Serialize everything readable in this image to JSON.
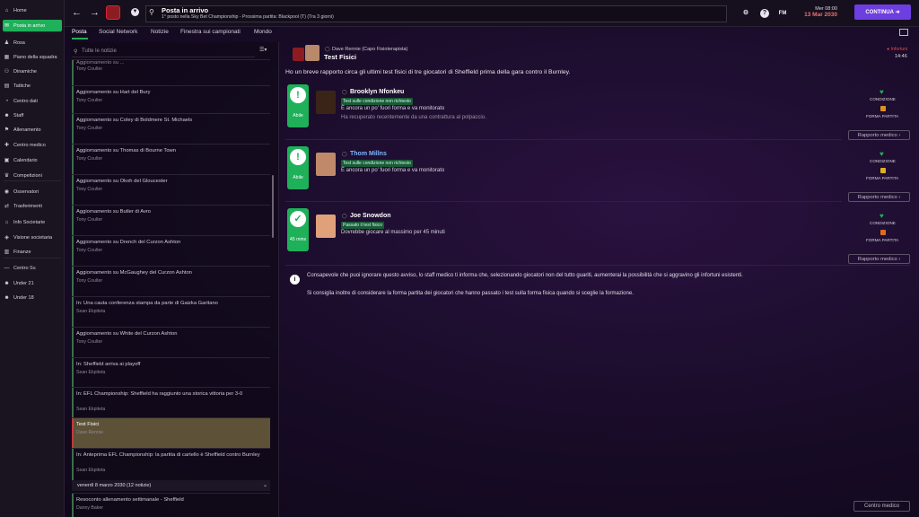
{
  "sidebar": {
    "items": [
      {
        "label": "Home",
        "icon": "home-icon",
        "glyph": "⌂"
      },
      {
        "label": "Posta in arrivo",
        "icon": "mail-icon",
        "glyph": "✉"
      },
      {
        "label": "Rosa",
        "icon": "squad-icon",
        "glyph": "♟"
      },
      {
        "label": "Piano della squadra",
        "icon": "plan-icon",
        "glyph": "▦"
      },
      {
        "label": "Dinamiche",
        "icon": "dynamics-icon",
        "glyph": "⚇"
      },
      {
        "label": "Tattiche",
        "icon": "tactics-icon",
        "glyph": "▤"
      },
      {
        "label": "Centro dati",
        "icon": "data-icon",
        "glyph": "◔"
      },
      {
        "label": "Staff",
        "icon": "staff-icon",
        "glyph": "☻"
      },
      {
        "label": "Allenamento",
        "icon": "training-icon",
        "glyph": "⚑"
      },
      {
        "label": "Centro medico",
        "icon": "medical-icon",
        "glyph": "✚"
      },
      {
        "label": "Calendario",
        "icon": "calendar-icon",
        "glyph": "▣"
      },
      {
        "label": "Competizioni",
        "icon": "trophy-icon",
        "glyph": "♛"
      },
      {
        "label": "Osservatori",
        "icon": "scouting-icon",
        "glyph": "◉"
      },
      {
        "label": "Trasferimenti",
        "icon": "transfers-icon",
        "glyph": "⇄"
      },
      {
        "label": "Info Societarie",
        "icon": "club-info-icon",
        "glyph": "⌂"
      },
      {
        "label": "Visione societaria",
        "icon": "vision-icon",
        "glyph": "◈"
      },
      {
        "label": "Finanze",
        "icon": "finances-icon",
        "glyph": "▥"
      },
      {
        "label": "Centro Sv.",
        "icon": "development-icon",
        "glyph": "—"
      },
      {
        "label": "Under 21",
        "icon": "u21-icon",
        "glyph": "☻"
      },
      {
        "label": "Under 18",
        "icon": "u18-icon",
        "glyph": "☻"
      }
    ]
  },
  "header": {
    "title": "Posta in arrivo",
    "subtitle": "1° posto nella Sky Bet Championship - Prossima partita: Blackpool (T) (Tra 3 giorni)",
    "time": "Mer 08:00",
    "date": "13 Mar 2030",
    "continue_label": "CONTINUA",
    "fm_label": "FM"
  },
  "tabs": [
    "Posta",
    "Social Network",
    "Notizie",
    "Finestra sui campionati",
    "Mondo"
  ],
  "list": {
    "filter_placeholder": "Tutte le notizie",
    "messages": [
      {
        "title": "Aggiornamento su ...",
        "sender": "Tony Coulter"
      },
      {
        "title": "Aggiornamento su Hart del Bury",
        "sender": "Tony Coulter"
      },
      {
        "title": "Aggiornamento su Coley di Boldmere St. Michaels",
        "sender": "Tony Coulter"
      },
      {
        "title": "Aggiornamento su Thomas di Bourne Town",
        "sender": "Tony Coulter"
      },
      {
        "title": "Aggiornamento su Okoh del Gloucester",
        "sender": "Tony Coulter"
      },
      {
        "title": "Aggiornamento su Butler di Avro",
        "sender": "Tony Coulter"
      },
      {
        "title": "Aggiornamento su Drench del Curzon Ashton",
        "sender": "Tony Coulter"
      },
      {
        "title": "Aggiornamento su McGaughey del Curzon Ashton",
        "sender": "Tony Coulter"
      },
      {
        "title": "In: Una cauta conferenza stampa da parte di Gaizka Garitano",
        "sender": "Sean Ekpiteta"
      },
      {
        "title": "Aggiornamento su White del Curzon Ashton",
        "sender": "Tony Coulter"
      },
      {
        "title": "In: Sheffield arriva ai playoff",
        "sender": "Sean Ekpiteta"
      },
      {
        "title": "In: EFL Championship: Sheffield ha raggiunto una storica vittoria per 3-0",
        "sender": "Sean Ekpiteta"
      },
      {
        "title": "Test Fisici",
        "sender": "Dave Rennie"
      },
      {
        "title": "In: Anteprima EFL Championship: la partita di cartello è Sheffield contro Burnley",
        "sender": "Sean Ekpiteta"
      }
    ],
    "date_group": "venerdì 8 marzo 2030 (12 notizie)",
    "last_message": {
      "title": "Resoconto allenamento settimanale - Sheffield",
      "sender": "Danny Baker"
    }
  },
  "detail": {
    "from": "Dave Rennie  (Capo Fisioterapista)",
    "subject": "Test Fisici",
    "tag": "Infortuni",
    "time": "14:46",
    "intro": "Ho un breve rapporto circa gli ultimi test fisici di tre giocatori di Sheffield prima della gara contro il Burnley.",
    "players": [
      {
        "name": "Brooklyn Nfonkeu",
        "badge": "Abile",
        "badge_glyph": "!",
        "tag": "Test sulle condizione non richiesto",
        "line1": "È ancora un po' fuori forma e va monitorato",
        "line2": "Ha recuperato recentemente da una contrattura al polpaccio.",
        "form_color": "#e09020",
        "photo_color": "#3a2418"
      },
      {
        "name": "Thom Millns",
        "badge": "Abile",
        "badge_glyph": "!",
        "tag": "Test sulle condizione non richiesto",
        "line1": "È ancora un po' fuori forma e va monitorato",
        "line2": "",
        "form_color": "#e0b020",
        "photo_color": "#c08a6a"
      },
      {
        "name": "Joe Snowdon",
        "badge": "45 mins",
        "badge_glyph": "✓",
        "tag": "Passato il test fisico",
        "line1": "Dovrebbe giocare al massimo per 45 minuti",
        "line2": "",
        "form_color": "#e06a20",
        "photo_color": "#e0a07a"
      }
    ],
    "condition_label": "CONDIZIONE",
    "form_label": "FORMA PARTITA",
    "medical_button": "Rapporto medico",
    "info1": "Consapevole che puoi ignorare questo avviso, lo staff medico ti informa che, selezionando giocatori non del tutto guariti, aumenterai la possibilità che si aggravino gli infortuni esistenti.",
    "info2": "Si consiglia inoltre di considerare la forma partita dei giocatori che hanno passato i test sulla forma fisica quando si sceglie la formazione.",
    "centro_button": "Centro medico"
  },
  "colors": {
    "accent_green": "#1fb05a",
    "continue_purple": "#6d3ee0",
    "date_red": "#f07070",
    "injury_red": "#e04848"
  }
}
